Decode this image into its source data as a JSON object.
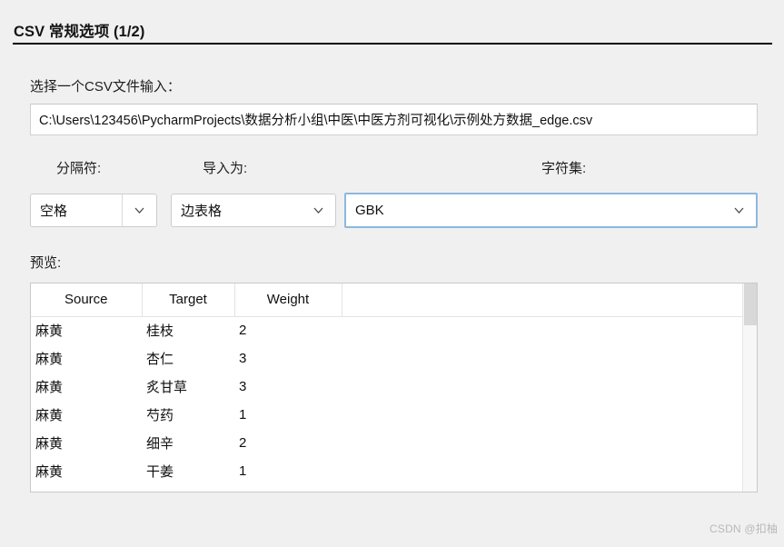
{
  "header": {
    "title": "CSV 常规选项 (1/2)"
  },
  "file_section": {
    "label": "选择一个CSV文件输入：",
    "path_value": "C:\\Users\\123456\\PycharmProjects\\数据分析小组\\中医\\中医方剂可视化\\示例处方数据_edge.csv",
    "path_placeholder": ""
  },
  "options": {
    "separator": {
      "label": "分隔符:",
      "value": "空格",
      "chevron_icon": "chevron-down-icon"
    },
    "import_as": {
      "label": "导入为:",
      "value": "边表格",
      "chevron_icon": "chevron-down-icon"
    },
    "charset": {
      "label": "字符集:",
      "value": "GBK",
      "chevron_icon": "chevron-down-icon",
      "focus_color": "#8cb8e0"
    }
  },
  "preview": {
    "label": "预览:",
    "columns": [
      "Source",
      "Target",
      "Weight",
      ""
    ],
    "rows": [
      {
        "source": "麻黄",
        "target": "桂枝",
        "weight": "2",
        "extra": ""
      },
      {
        "source": "麻黄",
        "target": "杏仁",
        "weight": "3",
        "extra": ""
      },
      {
        "source": "麻黄",
        "target": "炙甘草",
        "weight": "3",
        "extra": ""
      },
      {
        "source": "麻黄",
        "target": "芍药",
        "weight": "1",
        "extra": ""
      },
      {
        "source": "麻黄",
        "target": "细辛",
        "weight": "2",
        "extra": ""
      },
      {
        "source": "麻黄",
        "target": "干姜",
        "weight": "1",
        "extra": ""
      }
    ],
    "scrollbar": {
      "thumb_color": "#d8d8d8",
      "track_color": "#f7f7f7"
    }
  },
  "watermark": {
    "text": "CSDN @扣柚"
  }
}
